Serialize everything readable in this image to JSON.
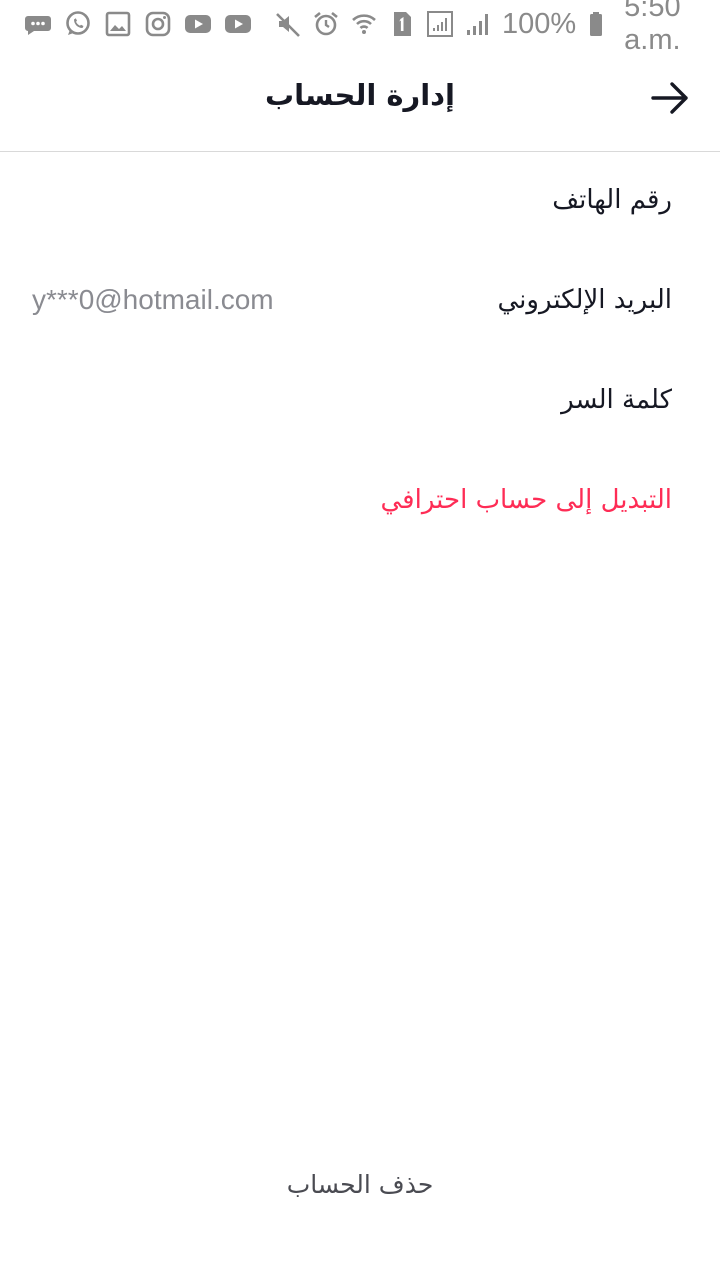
{
  "status_bar": {
    "left_icons": [
      "chat-bubble-icon",
      "whatsapp-icon",
      "gallery-icon",
      "instagram-icon",
      "youtube-icon",
      "youtube-icon"
    ],
    "right_icons": [
      "mute-icon",
      "alarm-icon",
      "wifi-icon",
      "sim1-icon",
      "signal-outline-icon",
      "signal-icon",
      "battery-icon"
    ],
    "battery": "100%",
    "time": "5:50 a.m."
  },
  "header": {
    "title": "إدارة الحساب"
  },
  "settings": {
    "items": [
      {
        "label": "رقم الهاتف",
        "value": ""
      },
      {
        "label": "البريد الإلكتروني",
        "value": "y***0@hotmail.com"
      },
      {
        "label": "كلمة السر",
        "value": ""
      },
      {
        "label": "التبديل إلى حساب احترافي",
        "value": ""
      }
    ]
  },
  "footer": {
    "delete_label": "حذف الحساب"
  },
  "colors": {
    "accent": "#fe2c55",
    "text_primary": "#161823",
    "text_secondary": "#8a8b91",
    "status_icons": "#8a8a8a"
  }
}
